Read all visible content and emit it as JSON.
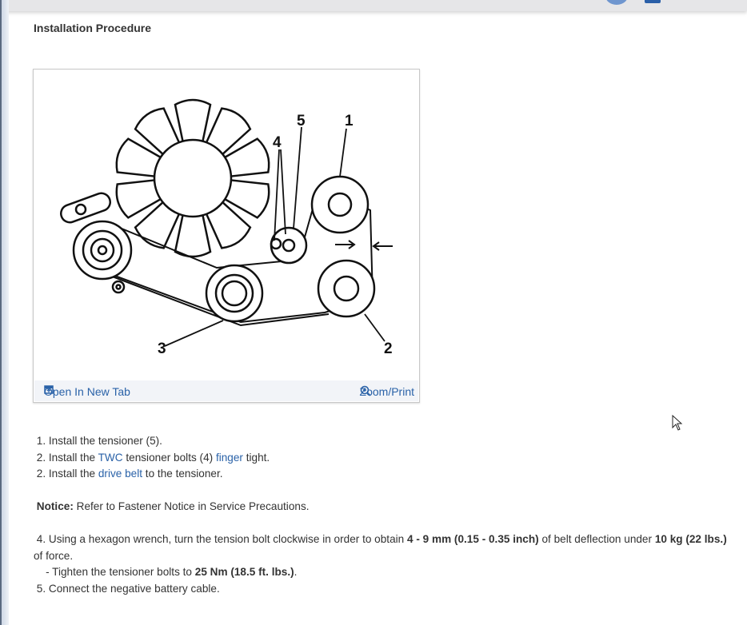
{
  "section_title": "Installation Procedure",
  "figure": {
    "callouts": {
      "c1": "1",
      "c2": "2",
      "c3": "3",
      "c4": "4",
      "c5": "5"
    },
    "open_new_tab": "Open In New Tab",
    "zoom_print": "Zoom/Print"
  },
  "steps": {
    "s1": "1. Install the tensioner (5).",
    "s2_pre": "2. Install the ",
    "s2_link1": "TWC",
    "s2_mid": " tensioner bolts (4) ",
    "s2_link2": "finger",
    "s2_post": " tight.",
    "s3_pre": "2. Install the ",
    "s3_link": "drive belt",
    "s3_post": " to the tensioner.",
    "notice_label": "Notice:",
    "notice_text": " Refer to Fastener Notice in Service Precautions.",
    "s4_pre": "4. Using a hexagon wrench, turn the tension bolt clockwise in order to obtain ",
    "s4_b1": "4 - 9 mm (0.15 - 0.35 inch)",
    "s4_mid": " of belt deflection under ",
    "s4_b2": "10 kg (22 lbs.)",
    "s4_post": " of force.",
    "sub_pre": "- Tighten the tensioner bolts to ",
    "sub_b": "25 Nm (18.5 ft. lbs.)",
    "sub_post": ".",
    "s5": "5. Connect the negative battery cable."
  },
  "colors": {
    "link": "#2a62a8",
    "text": "#333333",
    "footer_bg": "#f2f4f8"
  }
}
